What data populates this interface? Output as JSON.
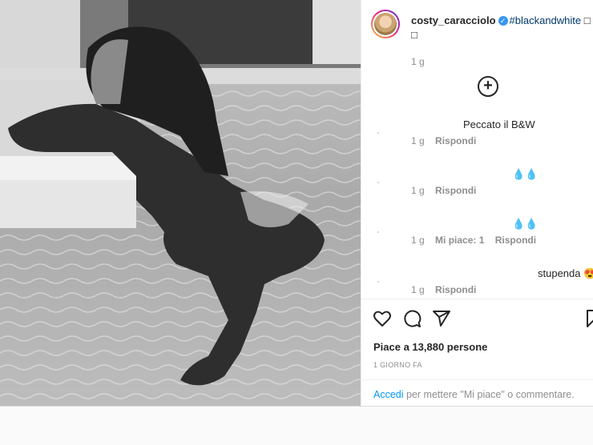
{
  "post": {
    "username": "costy_caracciolo",
    "verified_mark": "✓",
    "hashtag": "#blackandwhite",
    "caption_emoji": "□",
    "caption_line2": "□",
    "time": "1 g"
  },
  "comments": [
    {
      "text": "Peccato il B&W",
      "time": "1 g",
      "likes": "",
      "reply": "Rispondi"
    },
    {
      "text": "💧💧",
      "time": "1 g",
      "likes": "",
      "reply": "Rispondi"
    },
    {
      "text": "💧💧",
      "time": "1 g",
      "likes": "Mi piace: 1",
      "reply": "Rispondi"
    },
    {
      "text": "stupenda 😍",
      "time": "1 g",
      "likes": "",
      "reply": "Rispondi"
    }
  ],
  "load_more_icon": "plus-circle-icon",
  "load_more_glyph": "+",
  "likes_text": "Piace a 13,880 persone",
  "date_text": "1 GIORNO FA",
  "login": {
    "link": "Accedi",
    "rest": " per mettere \"Mi piace\" o commentare."
  },
  "colors": {
    "accent": "#0095f6",
    "hashtag": "#00376b",
    "muted": "#8e8e8e"
  }
}
